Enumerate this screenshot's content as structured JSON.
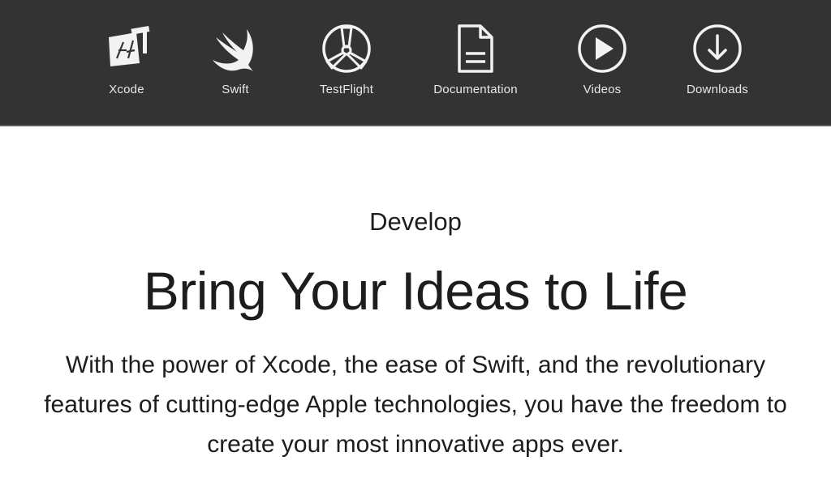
{
  "nav": {
    "items": [
      {
        "label": "Xcode",
        "icon": "xcode-icon"
      },
      {
        "label": "Swift",
        "icon": "swift-icon"
      },
      {
        "label": "TestFlight",
        "icon": "testflight-icon"
      },
      {
        "label": "Documentation",
        "icon": "documentation-icon"
      },
      {
        "label": "Videos",
        "icon": "videos-icon"
      },
      {
        "label": "Downloads",
        "icon": "downloads-icon"
      }
    ],
    "background": "#333333",
    "label_color": "#e8e8e8"
  },
  "hero": {
    "eyebrow": "Develop",
    "headline": "Bring Your Ideas to Life",
    "intro": "With the power of Xcode, the ease of Swift, and the revolutionary features of cutting-edge Apple technologies, you have the freedom to create your most innovative apps ever."
  }
}
